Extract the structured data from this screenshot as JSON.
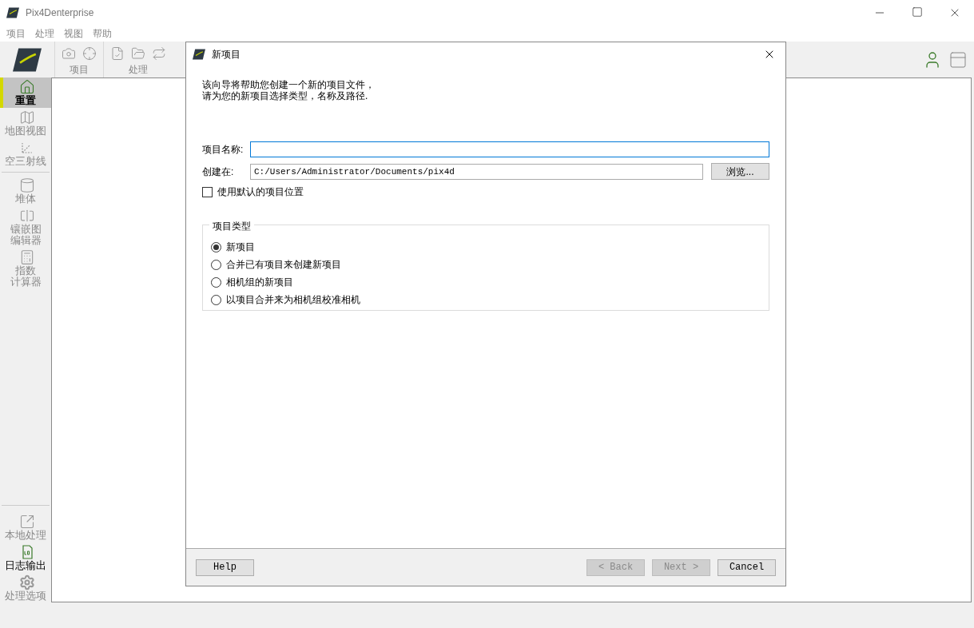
{
  "window": {
    "title": "Pix4Denterprise"
  },
  "menu": [
    "项目",
    "处理",
    "视图",
    "帮助"
  ],
  "toolbar": {
    "groups": [
      {
        "label": "项目"
      },
      {
        "label": "处理"
      }
    ]
  },
  "sidebar": {
    "top": [
      {
        "lines": [
          "重置"
        ],
        "selected": true,
        "disabled": false
      },
      {
        "lines": [
          "地图视图"
        ],
        "selected": false,
        "disabled": true
      },
      {
        "lines": [
          "空三射线"
        ],
        "selected": false,
        "disabled": true
      }
    ],
    "middle": [
      {
        "lines": [
          "堆体"
        ],
        "selected": false,
        "disabled": true
      },
      {
        "lines": [
          "镶嵌图",
          "编辑器"
        ],
        "selected": false,
        "disabled": true
      },
      {
        "lines": [
          "指数",
          "计算器"
        ],
        "selected": false,
        "disabled": true
      }
    ],
    "bottom": [
      {
        "lines": [
          "本地处理"
        ],
        "selected": false,
        "disabled": true
      },
      {
        "lines": [
          "日志输出"
        ],
        "selected": false,
        "disabled": false
      },
      {
        "lines": [
          "处理选项"
        ],
        "selected": false,
        "disabled": true
      }
    ]
  },
  "dialog": {
    "title": "新项目",
    "intro": [
      "该向导将帮助您创建一个新的项目文件，",
      "请为您的新项目选择类型，名称及路径."
    ],
    "name_field": {
      "label": "项目名称:"
    },
    "location_field": {
      "label": "创建在:",
      "value": "C:/Users/Administrator/Documents/pix4d",
      "button": "浏览..."
    },
    "default_location": {
      "label": "使用默认的项目位置",
      "checked": false
    },
    "project_type": {
      "title": "项目类型",
      "options": [
        {
          "label": "新项目",
          "selected": true
        },
        {
          "label": "合并已有项目来创建新项目",
          "selected": false
        },
        {
          "label": "相机组的新项目",
          "selected": false
        },
        {
          "label": "以项目合并来为相机组校准相机",
          "selected": false
        }
      ]
    },
    "buttons": [
      {
        "label": "Help",
        "disabled": false
      },
      {
        "label": "< Back",
        "disabled": true
      },
      {
        "label": "Next >",
        "disabled": true
      },
      {
        "label": "Cancel",
        "disabled": false
      }
    ]
  }
}
